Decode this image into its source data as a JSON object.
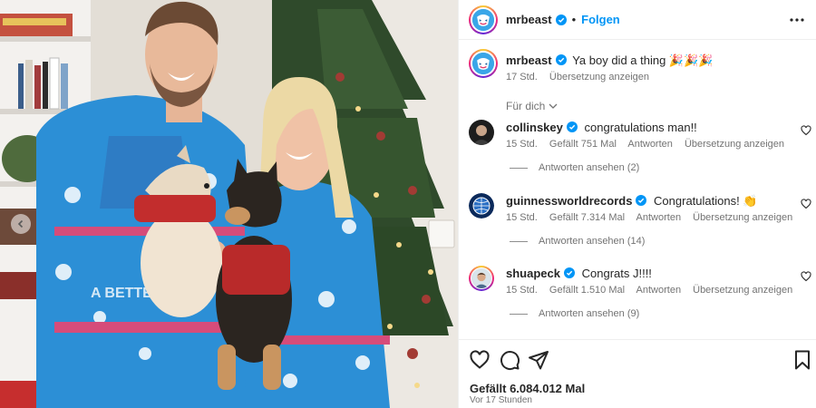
{
  "post": {
    "username": "mrbeast",
    "dot": "•",
    "follow_label": "Folgen",
    "caption_text": "Ya boy did a thing 🎉🎉🎉",
    "caption_time": "17 Std.",
    "caption_translate": "Übersetzung anzeigen",
    "sort_label": "Für dich",
    "likes_text": "Gefällt 6.084.012 Mal",
    "time_ago": "Vor 17 Stunden"
  },
  "comments": [
    {
      "username": "collinskey",
      "text": "congratulations man!!",
      "time": "15 Std.",
      "likes": "Gefällt 751 Mal",
      "reply": "Antworten",
      "translate": "Übersetzung anzeigen",
      "view_replies": "Antworten ansehen (2)"
    },
    {
      "username": "guinnessworldrecords",
      "text": "Congratulations! 👏",
      "time": "15 Std.",
      "likes": "Gefällt 7.314 Mal",
      "reply": "Antworten",
      "translate": "Übersetzung anzeigen",
      "view_replies": "Antworten ansehen (14)"
    },
    {
      "username": "shuapeck",
      "text": "Congrats J!!!!",
      "time": "15 Std.",
      "likes": "Gefällt 1.510 Mal",
      "reply": "Antworten",
      "translate": "Übersetzung anzeigen",
      "view_replies": "Antworten ansehen (9)"
    }
  ],
  "icons": {
    "more": "more-horizontal-icon",
    "verified": "verified-badge-icon",
    "like": "heart-icon",
    "comment": "comment-icon",
    "share": "share-icon",
    "save": "bookmark-icon",
    "carousel_prev": "chevron-left-icon"
  },
  "colors": {
    "link_blue": "#0095f6",
    "verified_blue": "#0095f6",
    "muted_text": "#737373",
    "divider": "#efefef",
    "sweater_blue": "#2c8fd6"
  }
}
